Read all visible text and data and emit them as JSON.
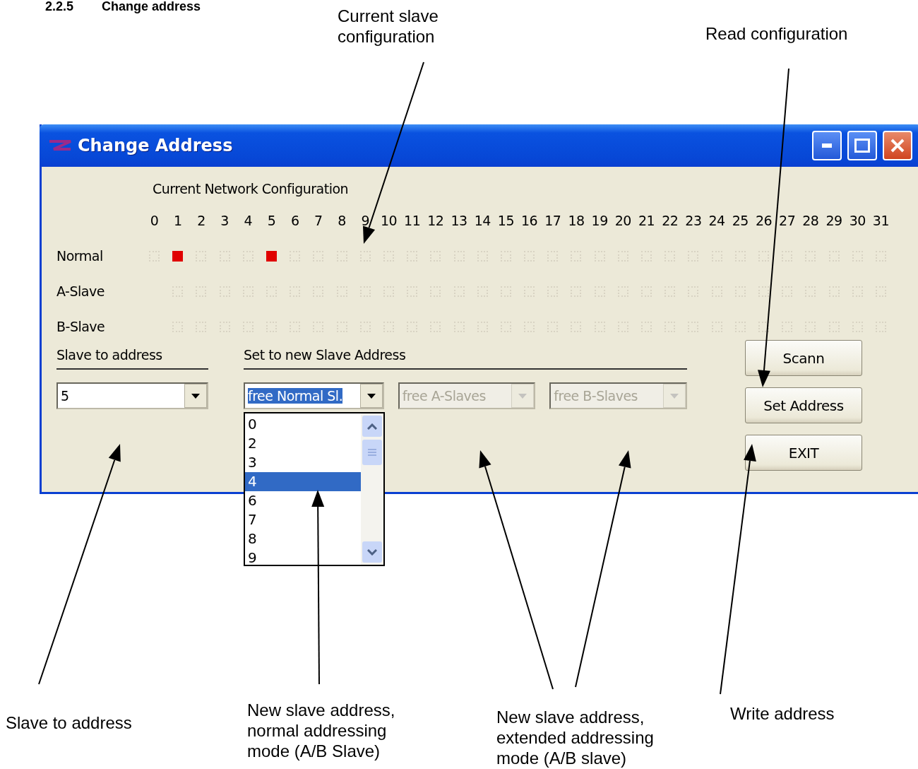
{
  "heading": {
    "number": "2.2.5",
    "title": "Change address"
  },
  "window": {
    "title": "Change Address",
    "group_title": "Current Network Configuration",
    "columns": [
      "0",
      "1",
      "2",
      "3",
      "4",
      "5",
      "6",
      "7",
      "8",
      "9",
      "10",
      "11",
      "12",
      "13",
      "14",
      "15",
      "16",
      "17",
      "18",
      "19",
      "20",
      "21",
      "22",
      "23",
      "24",
      "25",
      "26",
      "27",
      "28",
      "29",
      "30",
      "31"
    ],
    "rows": [
      {
        "label": "Normal",
        "cells": [
          false,
          true,
          false,
          false,
          false,
          true,
          false,
          false,
          false,
          false,
          false,
          false,
          false,
          false,
          false,
          false,
          false,
          false,
          false,
          false,
          false,
          false,
          false,
          false,
          false,
          false,
          false,
          false,
          false,
          false,
          false,
          false
        ]
      },
      {
        "label": "A-Slave",
        "cells": [
          false,
          false,
          false,
          false,
          false,
          false,
          false,
          false,
          false,
          false,
          false,
          false,
          false,
          false,
          false,
          false,
          false,
          false,
          false,
          false,
          false,
          false,
          false,
          false,
          false,
          false,
          false,
          false,
          false,
          false,
          false
        ]
      },
      {
        "label": "B-Slave",
        "cells": [
          false,
          false,
          false,
          false,
          false,
          false,
          false,
          false,
          false,
          false,
          false,
          false,
          false,
          false,
          false,
          false,
          false,
          false,
          false,
          false,
          false,
          false,
          false,
          false,
          false,
          false,
          false,
          false,
          false,
          false,
          false
        ]
      }
    ],
    "slave_group": {
      "title": "Slave to address",
      "value": "5"
    },
    "new_group": {
      "title": "Set to new Slave Address",
      "combos": [
        {
          "value": "free Normal Sl.",
          "disabled": false,
          "expanded": true
        },
        {
          "value": "free A-Slaves",
          "disabled": true,
          "expanded": false
        },
        {
          "value": "free B-Slaves",
          "disabled": true,
          "expanded": false
        }
      ],
      "options": [
        {
          "label": "0",
          "selected": false
        },
        {
          "label": "2",
          "selected": false
        },
        {
          "label": "3",
          "selected": false
        },
        {
          "label": "4",
          "selected": true
        },
        {
          "label": "6",
          "selected": false
        },
        {
          "label": "7",
          "selected": false
        },
        {
          "label": "8",
          "selected": false
        },
        {
          "label": "9",
          "selected": false
        }
      ]
    },
    "buttons": [
      "Scann",
      "Set Address",
      "EXIT"
    ]
  },
  "annotations": [
    {
      "text": "Current slave configuration"
    },
    {
      "text": "Read configuration"
    },
    {
      "text": "Slave to address"
    },
    {
      "text": "New slave address, normal addressing mode (A/B Slave)"
    },
    {
      "text": "New slave address, extended addressing mode (A/B slave)"
    },
    {
      "text": "Write address"
    }
  ]
}
